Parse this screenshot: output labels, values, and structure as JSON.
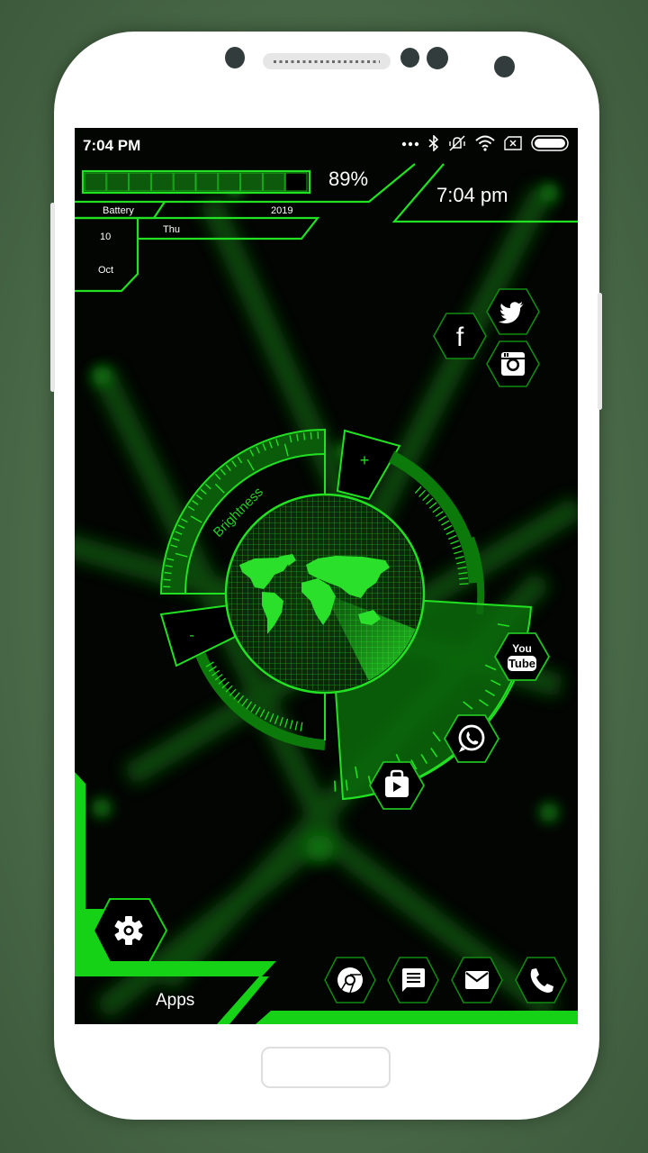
{
  "status_bar": {
    "time": "7:04 PM",
    "icons": [
      "more-dots-icon",
      "bluetooth-icon",
      "vibrate-mute-icon",
      "wifi-icon",
      "no-sim-icon",
      "battery-icon"
    ]
  },
  "widget": {
    "battery_percent_text": "89%",
    "battery_level": 0.89,
    "battery_segments": 10,
    "battery_label": "Battery",
    "year": "2019",
    "weekday": "Thu",
    "day": "10",
    "month": "Oct",
    "clock": "7:04 pm"
  },
  "social_icons": [
    {
      "name": "facebook",
      "glyph": "f"
    },
    {
      "name": "twitter"
    },
    {
      "name": "instagram"
    }
  ],
  "radar": {
    "brightness_label": "Brightness",
    "plus_label": "+",
    "minus_label": "-"
  },
  "arc_apps": [
    {
      "name": "youtube",
      "line1": "You",
      "line2": "Tube"
    },
    {
      "name": "whatsapp"
    },
    {
      "name": "play-store"
    }
  ],
  "settings": {
    "name": "settings"
  },
  "apps_label": "Apps",
  "dock": [
    {
      "name": "chrome"
    },
    {
      "name": "messages"
    },
    {
      "name": "email"
    },
    {
      "name": "phone"
    }
  ],
  "colors": {
    "accent": "#1ee81e",
    "accent_dark": "#0b7a0b",
    "screen_bg": "#020502",
    "frame_bg": "#4a6a48",
    "phone_body": "#ffffff"
  }
}
